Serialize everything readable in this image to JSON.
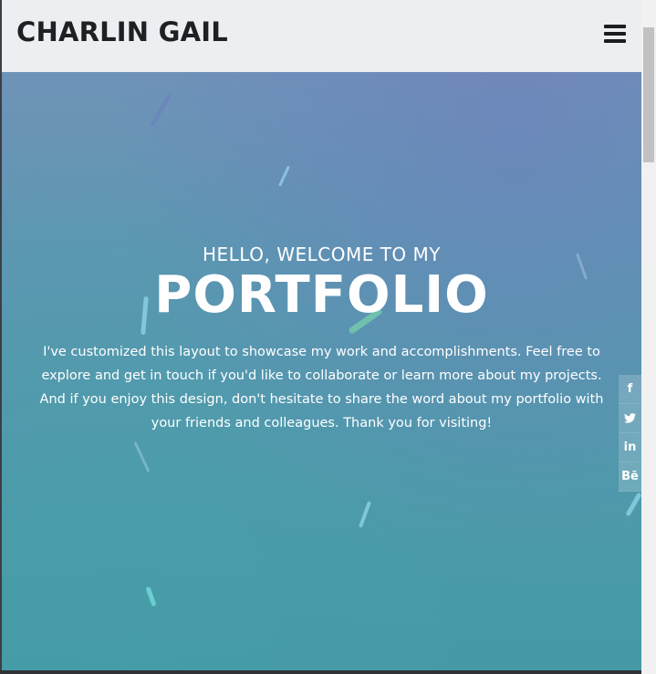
{
  "header": {
    "brand": "CHARLIN GAIL",
    "menu_icon": "hamburger-icon"
  },
  "hero": {
    "greeting": "HELLO, WELCOME TO MY",
    "headline": "PORTFOLIO",
    "intro": "I've customized this layout to showcase my work and accomplishments. Feel free to explore and get in touch if you'd like to collaborate or learn more about my projects. And if you enjoy this design, don't hesitate to share the word about my portfolio with your friends and colleagues. Thank you for visiting!"
  },
  "social": [
    {
      "icon": "facebook-icon",
      "glyph": "f"
    },
    {
      "icon": "twitter-icon",
      "glyph": "🐦"
    },
    {
      "icon": "linkedin-icon",
      "glyph": "in"
    },
    {
      "icon": "behance-icon",
      "glyph": "Bē"
    }
  ],
  "colors": {
    "header_bg": "#ebeff2",
    "brand_text": "#1e2124",
    "hero_top": "#6f93b8",
    "hero_bottom": "#459aa5",
    "hero_text": "#ffffff"
  }
}
